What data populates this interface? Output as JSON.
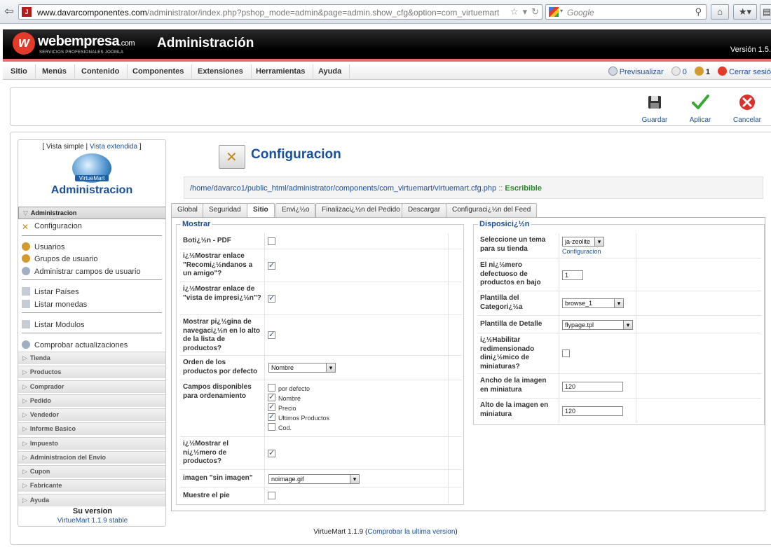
{
  "browser": {
    "url_domain": "www.davarcomponentes.com",
    "url_path": "/administrator/index.php?pshop_mode=admin&page=admin.show_cfg&option=com_virtuemart",
    "search_placeholder": "Google",
    "favicon_letter": "J"
  },
  "header": {
    "logo_text": "webempresa",
    "logo_suffix": ".com",
    "logo_tagline": "SERVICIOS PROFESIONALES JOOMLA",
    "title": "Administración",
    "version": "Versión 1.5."
  },
  "menu": {
    "items": [
      "Sitio",
      "Menús",
      "Contenido",
      "Componentes",
      "Extensiones",
      "Herramientas",
      "Ayuda"
    ],
    "preview": "Previsualizar",
    "messages_count": "0",
    "users_count": "1",
    "logout": "Cerrar sesió"
  },
  "toolbar": {
    "save": "Guardar",
    "apply": "Aplicar",
    "cancel": "Cancelar"
  },
  "sidebar": {
    "view_open": "[ ",
    "view_simple": "Vista simple",
    "view_pipe": " | ",
    "view_extended": "Vista extendida",
    "view_close": " ]",
    "logo_label": "VirtueMart",
    "title": "Administracion",
    "active_section": "Administracion",
    "admin_items": [
      "Configuracion",
      "Usuarios",
      "Grupos de usuario",
      "Administrar campos de usuario",
      "Listar Países",
      "Listar monedas",
      "Listar Modulos",
      "Comprobar actualizaciones"
    ],
    "sections": [
      "Tienda",
      "Productos",
      "Comprador",
      "Pedido",
      "Vendedor",
      "Informe Basico",
      "Impuesto",
      "Administracion del Envio",
      "Cupon",
      "Fabricante",
      "Ayuda"
    ],
    "version_heading": "Su version",
    "version_value": "VirtueMart 1.1.9 stable"
  },
  "config": {
    "title": "Configuracion",
    "path": "/home/davarco1/public_html/administrator/components/com_virtuemart/virtuemart.cfg.php",
    "path_sep": " :: ",
    "writable": "Escribible"
  },
  "tabs": [
    "Global",
    "Seguridad",
    "Sitio",
    "Envi¿½o",
    "Finalizaci¿½n del Pedido",
    "Descargar",
    "Configuraci¿½n del Feed"
  ],
  "mostrar": {
    "legend": "Mostrar",
    "pdf_label": "Boti¿½n - PDF",
    "recommend_label": "i¿½Mostrar enlace \"Recomi¿½ndanos a un amigo\"?",
    "print_label": "i¿½Mostrar enlace de \"vista de impresi¿½n\"?",
    "paging_label": "Mostrar pi¿½gina de navegaci¿½n en lo alto de la lista de productos?",
    "order_label": "Orden de los productos por defecto",
    "order_value": "Nombre",
    "fields_label": "Campos disponibles para ordenamiento",
    "fields_options": [
      "por defecto",
      "Nombre",
      "Precio",
      "Ultimos Productos",
      "Cod."
    ],
    "count_label": "i¿½Mostrar el ni¿½mero de productos?",
    "noimage_label": "imagen \"sin imagen\"",
    "noimage_value": "noimage.gif",
    "footer_label": "Muestre el pie"
  },
  "disposicion": {
    "legend": "Disposici¿½n",
    "theme_label": "Seleccione un tema para su tienda",
    "theme_value": "ja-zeolite",
    "theme_link": "Configuracion",
    "perpage_label": "El ni¿½mero defectuoso de productos en bajo",
    "perpage_value": "1",
    "category_label": "Plantilla del Categori¿½a",
    "category_value": "browse_1",
    "detail_label": "Plantilla de Detalle",
    "detail_value": "flypage.tpl",
    "resize_label": "i¿½Habilitar redimensionado dini¿½mico de miniaturas?",
    "width_label": "Ancho de la imagen en miniatura",
    "width_value": "120",
    "height_label": "Alto de la imagen en miniatura",
    "height_value": "120"
  },
  "footer": {
    "text": "VirtueMart 1.1.9 (",
    "link": "Comprobar la ultima version",
    "close": ")"
  }
}
